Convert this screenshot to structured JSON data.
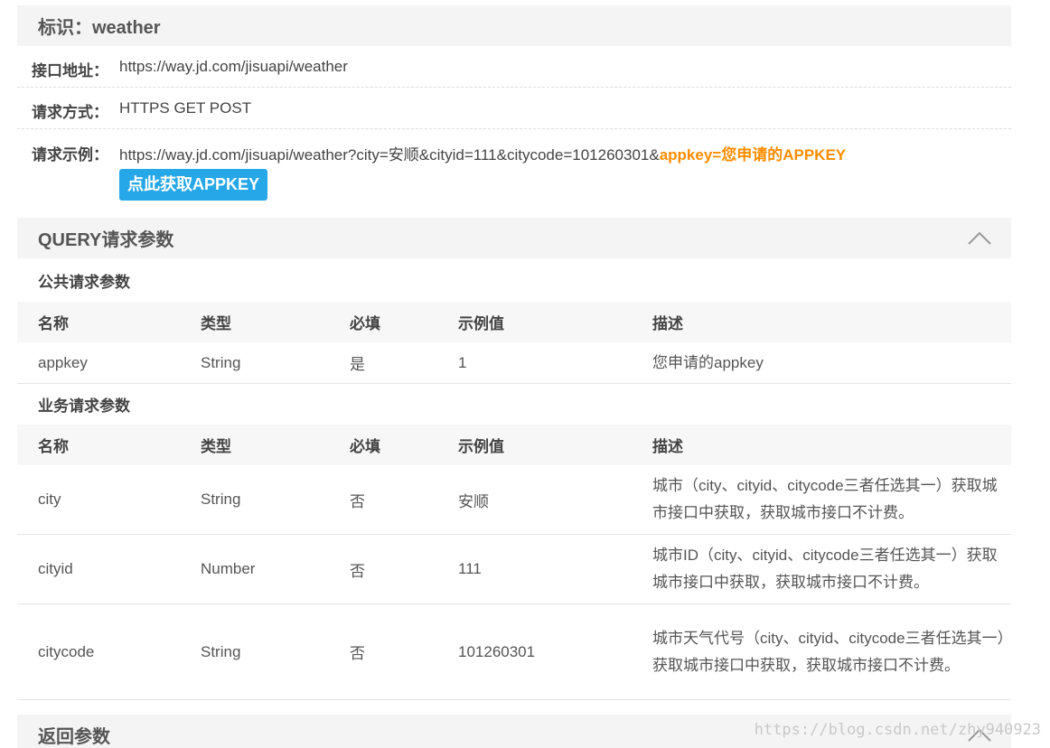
{
  "section1": {
    "title": "标识：weather"
  },
  "info": {
    "address": {
      "label": "接口地址：",
      "value": "https://way.jd.com/jisuapi/weather"
    },
    "method": {
      "label": "请求方式：",
      "value": "HTTPS GET POST"
    },
    "example": {
      "label": "请求示例：",
      "value": "https://way.jd.com/jisuapi/weather?city=安顺&cityid=111&citycode=101260301&",
      "highlight": "appkey=您申请的APPKEY"
    },
    "button_label": "点此获取APPKEY"
  },
  "query": {
    "title": "QUERY请求参数",
    "public_title": "公共请求参数",
    "headers": [
      "名称",
      "类型",
      "必填",
      "示例值",
      "描述"
    ],
    "public_rows": [
      [
        "appkey",
        "String",
        "是",
        "1",
        "您申请的appkey"
      ]
    ],
    "biz_title": "业务请求参数",
    "biz_rows": [
      [
        "city",
        "String",
        "否",
        "安顺",
        "城市（city、cityid、citycode三者任选其一）获取城市接口中获取，获取城市接口不计费。"
      ],
      [
        "cityid",
        "Number",
        "否",
        "111",
        "城市ID（city、cityid、citycode三者任选其一）获取城市接口中获取，获取城市接口不计费。"
      ],
      [
        "citycode",
        "String",
        "否",
        "101260301",
        "城市天气代号（city、cityid、citycode三者任选其一）获取城市接口中获取，获取城市接口不计费。"
      ]
    ]
  },
  "response": {
    "title": "返回参数"
  },
  "watermark": "https://blog.csdn.net/zhy940923",
  "icons": {
    "collapse": "chevron-up-icon"
  }
}
